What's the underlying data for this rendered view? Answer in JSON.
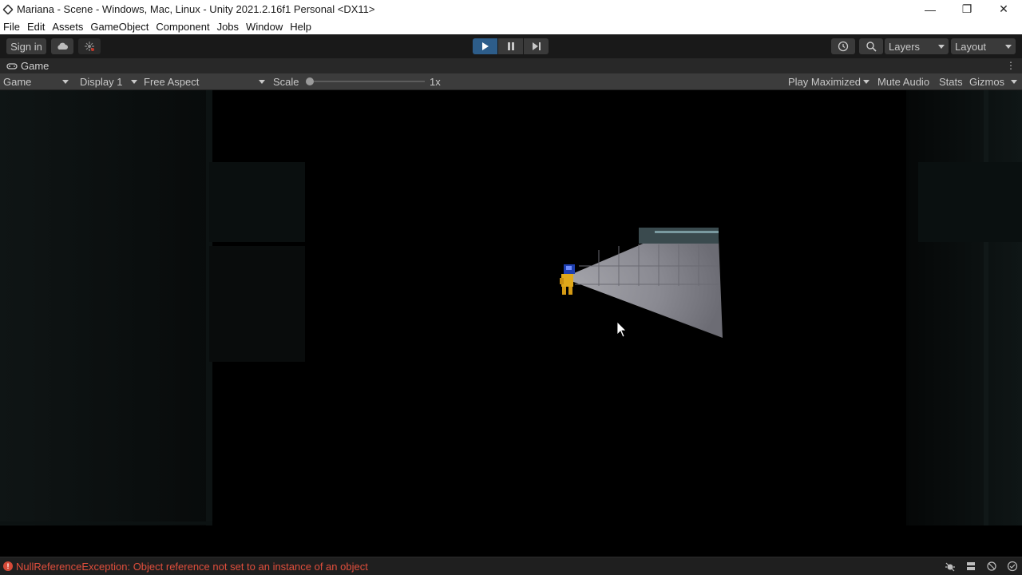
{
  "window": {
    "title": "Mariana - Scene - Windows, Mac, Linux - Unity 2021.2.16f1 Personal <DX11>",
    "controls": {
      "minimize": "—",
      "restore": "❐",
      "close": "✕"
    }
  },
  "menu": {
    "items": [
      "File",
      "Edit",
      "Assets",
      "GameObject",
      "Component",
      "Jobs",
      "Window",
      "Help"
    ]
  },
  "toolbar": {
    "sign_in": "Sign in",
    "layers_label": "Layers",
    "layout_label": "Layout",
    "play_active": true,
    "accent_color": "#2d5d8a"
  },
  "tab": {
    "label": "Game"
  },
  "game_controls": {
    "view_mode": "Game",
    "display": "Display 1",
    "aspect": "Free Aspect",
    "scale_label": "Scale",
    "scale_value": "1x",
    "scale_fraction": 0.0,
    "play_maximized": "Play Maximized",
    "mute_audio": "Mute Audio",
    "stats": "Stats",
    "gizmos": "Gizmos"
  },
  "status": {
    "error_message": "NullReferenceException: Object reference not set to an instance of an object",
    "error_color": "#e04e3c"
  }
}
